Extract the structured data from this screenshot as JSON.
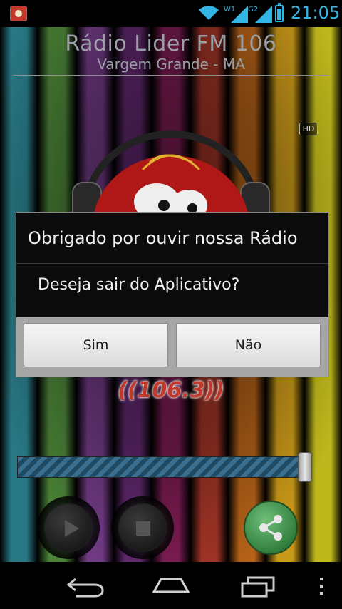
{
  "status_bar": {
    "time": "21:05",
    "sim1_label": "W1",
    "sim2_label": "G2",
    "battery_level": 0.8,
    "accent_color": "#33b5e5",
    "icons": [
      "app-notification-icon",
      "wifi-icon",
      "signal-icon",
      "signal-icon",
      "battery-icon"
    ]
  },
  "header": {
    "title": "Rádio Lider FM 106",
    "subtitle": "Vargem Grande - MA"
  },
  "hd_badge": "HD",
  "frequency_label": "((106.3))",
  "dialog": {
    "title": "Obrigado por ouvir nossa Rádio",
    "message": "Deseja sair do Aplicativo?",
    "yes_label": "Sim",
    "no_label": "Não"
  },
  "player": {
    "volume_level": 0.97,
    "play_icon": "play-icon",
    "stop_icon": "stop-icon",
    "share_icon": "share-icon"
  },
  "nav_bar": {
    "icons": [
      "back-icon",
      "home-icon",
      "recent-apps-icon",
      "overflow-menu-icon"
    ]
  },
  "colors": {
    "stripes": [
      "#2a7f8c",
      "#4f8a3a",
      "#7a3f8f",
      "#6b2d7a",
      "#8a1f5c",
      "#b33a2a",
      "#c46a1a",
      "#d4a11a",
      "#c9c21e"
    ],
    "brand_red": "#c0392b",
    "share_green": "#3f9a4c"
  }
}
